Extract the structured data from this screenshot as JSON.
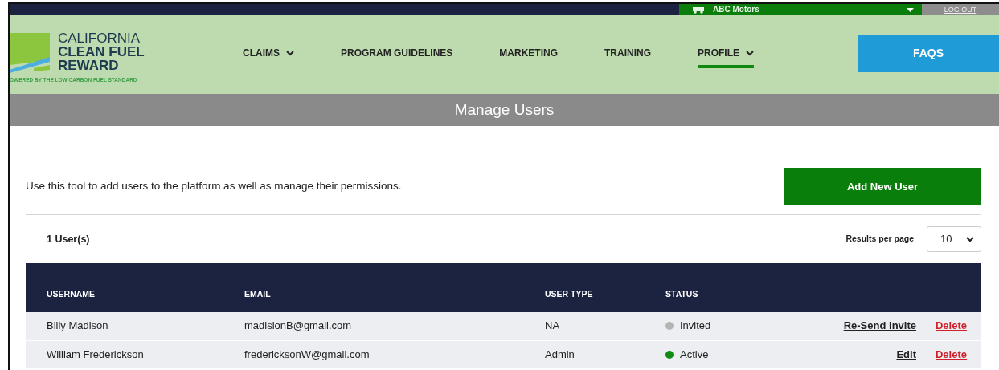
{
  "top_bar": {
    "dealer": "ABC Motors",
    "logout": "LOG OUT"
  },
  "logo": {
    "line_1": "CALIFORNIA",
    "line_2": "CLEAN FUEL",
    "line_3": "REWARD",
    "tagline": "OWERED BY THE LOW CARBON FUEL STANDARD"
  },
  "nav": [
    {
      "label": "CLAIMS",
      "dropdown": true,
      "selected": false
    },
    {
      "label": "PROGRAM GUIDELINES",
      "dropdown": false,
      "selected": false
    },
    {
      "label": "MARKETING",
      "dropdown": false,
      "selected": false
    },
    {
      "label": "TRAINING",
      "dropdown": false,
      "selected": false
    },
    {
      "label": "PROFILE",
      "dropdown": true,
      "selected": true
    }
  ],
  "faqs_button": "FAQS",
  "page_title": "Manage Users",
  "description": "Use this tool to add users to the platform as well as manage their permissions.",
  "add_button": "Add New User",
  "user_count": "1 User(s)",
  "results_per_page": {
    "label": "Results per page",
    "value": "10"
  },
  "table": {
    "columns": [
      "USERNAME",
      "EMAIL",
      "USER TYPE",
      "STATUS"
    ],
    "rows": [
      {
        "username": "Billy Madison",
        "email": "madisionB@gmail.com",
        "user_type": "NA",
        "status": "Invited",
        "color": "#b4b4b4",
        "actions": [
          {
            "label": "Re-Send Invite",
            "kind": "normal"
          },
          {
            "label": "Delete",
            "kind": "danger"
          }
        ]
      },
      {
        "username": "William Frederickson",
        "email": "fredericksonW@gmail.com",
        "user_type": "Admin",
        "status": "Active",
        "color": "#108a10",
        "actions": [
          {
            "label": "Edit",
            "kind": "normal"
          },
          {
            "label": "Delete",
            "kind": "danger"
          }
        ]
      }
    ]
  }
}
